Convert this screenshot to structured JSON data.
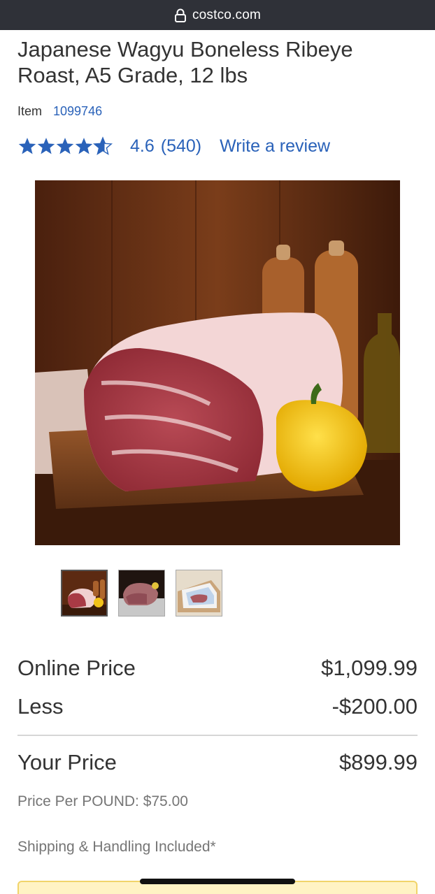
{
  "browser": {
    "domain": "costco.com",
    "lock_icon": "lock-icon"
  },
  "product": {
    "title": "Japanese Wagyu Boneless Ribeye Roast, A5 Grade, 12 lbs",
    "item_label": "Item",
    "item_number": "1099746"
  },
  "rating": {
    "stars_value": 4.6,
    "score": "4.6",
    "count": "(540)",
    "write_review": "Write a review",
    "star_color": "#2a62b9"
  },
  "gallery": {
    "thumbnail_count": 3,
    "selected_index": 0
  },
  "pricing": {
    "online_label": "Online Price",
    "online_value": "$1,099.99",
    "less_label": "Less",
    "less_value": "-$200.00",
    "your_label": "Your Price",
    "your_value": "$899.99",
    "per_pound": "Price Per POUND: $75.00",
    "shipping": "Shipping & Handling Included*"
  },
  "colors": {
    "link": "#2a62b9",
    "url_bar": "#2f3138",
    "cta_background": "#fff3c4"
  }
}
